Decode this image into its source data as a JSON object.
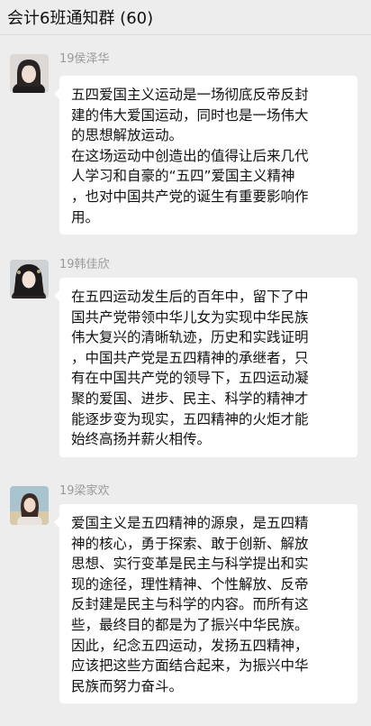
{
  "header": {
    "title": "会计6班通知群 (60)"
  },
  "messages": [
    {
      "sender": "19侯泽华",
      "lines": [
        "五四爱国主义运动是一场彻底反帝反封",
        "建的伟大爱国运动，同时也是一场伟大",
        "的思想解放运动。",
        "在这场运动中创造出的值得让后来几代",
        "人学习和自豪的“五四”爱国主义精神",
        "，也对中国共产党的诞生有重要影响作",
        "用。"
      ]
    },
    {
      "sender": "19韩佳欣",
      "lines": [
        "在五四运动发生后的百年中，留下了中",
        "国共产党带领中华儿女为实现中华民族",
        "伟大复兴的清晰轨迹，历史和实践证明",
        "，中国共产党是五四精神的承继者，只",
        "有在中国共产党的领导下，五四运动凝",
        "聚的爱国、进步、民主、科学的精神才",
        "能逐步变为现实，五四精神的火炬才能",
        "始终高扬并薪火相传。"
      ]
    },
    {
      "sender": "19梁家欢",
      "lines": [
        "爱国主义是五四精神的源泉，是五四精",
        "神的核心，勇于探索、敢于创新、解放",
        "思想、实行变革是民主与科学提出和实",
        "现的途径，理性精神、个性解放、反帝",
        "反封建是民主与科学的内容。而所有这",
        "些，最终目的都是为了振兴中华民族。",
        "因此，纪念五四运动，发扬五四精神，",
        "应该把这些方面结合起来，为振兴中华",
        "民族而努力奋斗。"
      ]
    }
  ]
}
